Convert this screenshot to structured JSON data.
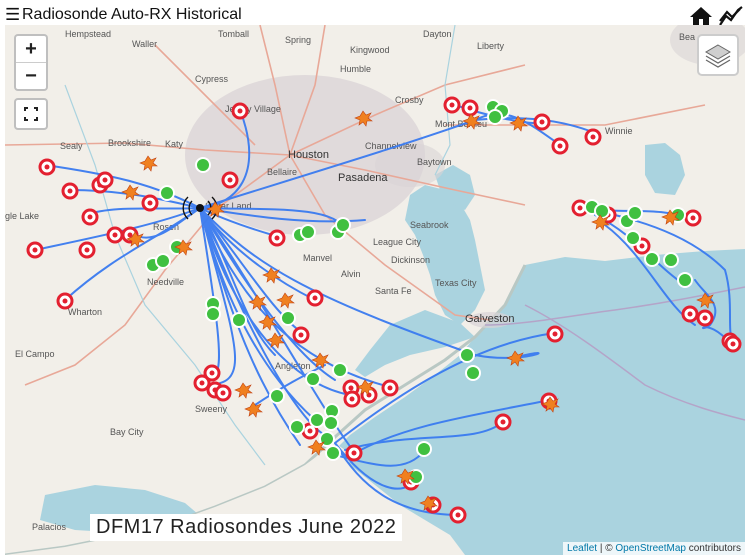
{
  "header": {
    "title": "Radiosonde Auto-RX Historical",
    "menu_glyph": "☰",
    "home_icon": "home-icon",
    "chart_icon": "chart-icon"
  },
  "map": {
    "zoom_in": "+",
    "zoom_out": "−",
    "fullscreen_icon": "fullscreen-icon",
    "layers_icon": "layers-icon",
    "caption": "DFM17 Radiosondes June 2022",
    "attribution": {
      "leaflet": "Leaflet",
      "separator": " | © ",
      "osm": "OpenStreetMap",
      "contributors": " contributors"
    },
    "colors": {
      "track": "#3a7bf0",
      "land": "#f2efe9",
      "water": "#aad3df",
      "urban": "#d9d3d6",
      "marker_red": "#e32030",
      "marker_green": "#40c040"
    },
    "places": {
      "hempstead": "Hempstead",
      "waller": "Waller",
      "tomball": "Tomball",
      "spring": "Spring",
      "kingwood": "Kingwood",
      "liberty": "Liberty",
      "dayton": "Dayton",
      "beaumont": "Bea",
      "cypress": "Cypress",
      "humble": "Humble",
      "jersey_village": "Jersey Village",
      "crosby": "Crosby",
      "mont_belvieu": "Mont Belvieu",
      "winnie": "Winnie",
      "sealy": "Sealy",
      "brookshire": "Brookshire",
      "katy": "Katy",
      "houston": "Houston",
      "channelview": "Channelview",
      "baytown": "Baytown",
      "bellaire": "Bellaire",
      "pasadena": "Pasadena",
      "eagle_lake": "gle Lake",
      "sugar_land": "Sugar Land",
      "seabrook": "Seabrook",
      "rosenberg": "Rosen",
      "league_city": "League City",
      "dickinson": "Dickinson",
      "manvel": "Manvel",
      "alvin": "Alvin",
      "needville": "Needville",
      "santa_fe": "Santa Fe",
      "texas_city": "Texas City",
      "wharton": "Wharton",
      "galveston": "Galveston",
      "el_campo": "El Campo",
      "angleton": "Angleton",
      "sweeny": "Sweeny",
      "bay_city": "Bay City",
      "palacios": "Palacios"
    }
  }
}
